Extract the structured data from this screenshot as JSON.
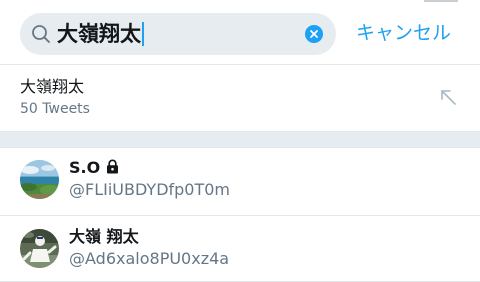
{
  "search": {
    "query": "大嶺翔太",
    "icon": "search-icon",
    "clear_icon": "clear-icon",
    "accent": "#1da1f2"
  },
  "header": {
    "cancel_label": "キャンセル"
  },
  "suggestion": {
    "title": "大嶺翔太",
    "count": "50 Tweets",
    "icon": "arrow-up-left-icon"
  },
  "users": [
    {
      "name": "S.O",
      "handle": "@FLIiUBDYDfp0T0m",
      "protected": true,
      "lock_icon": "lock-icon"
    },
    {
      "name": "大嶺 翔太",
      "handle": "@Ad6xalo8PU0xz4a",
      "protected": false
    }
  ],
  "colors": {
    "accent": "#1da1f2",
    "secondary_text": "#657786",
    "section_background": "#e6ecf0"
  }
}
